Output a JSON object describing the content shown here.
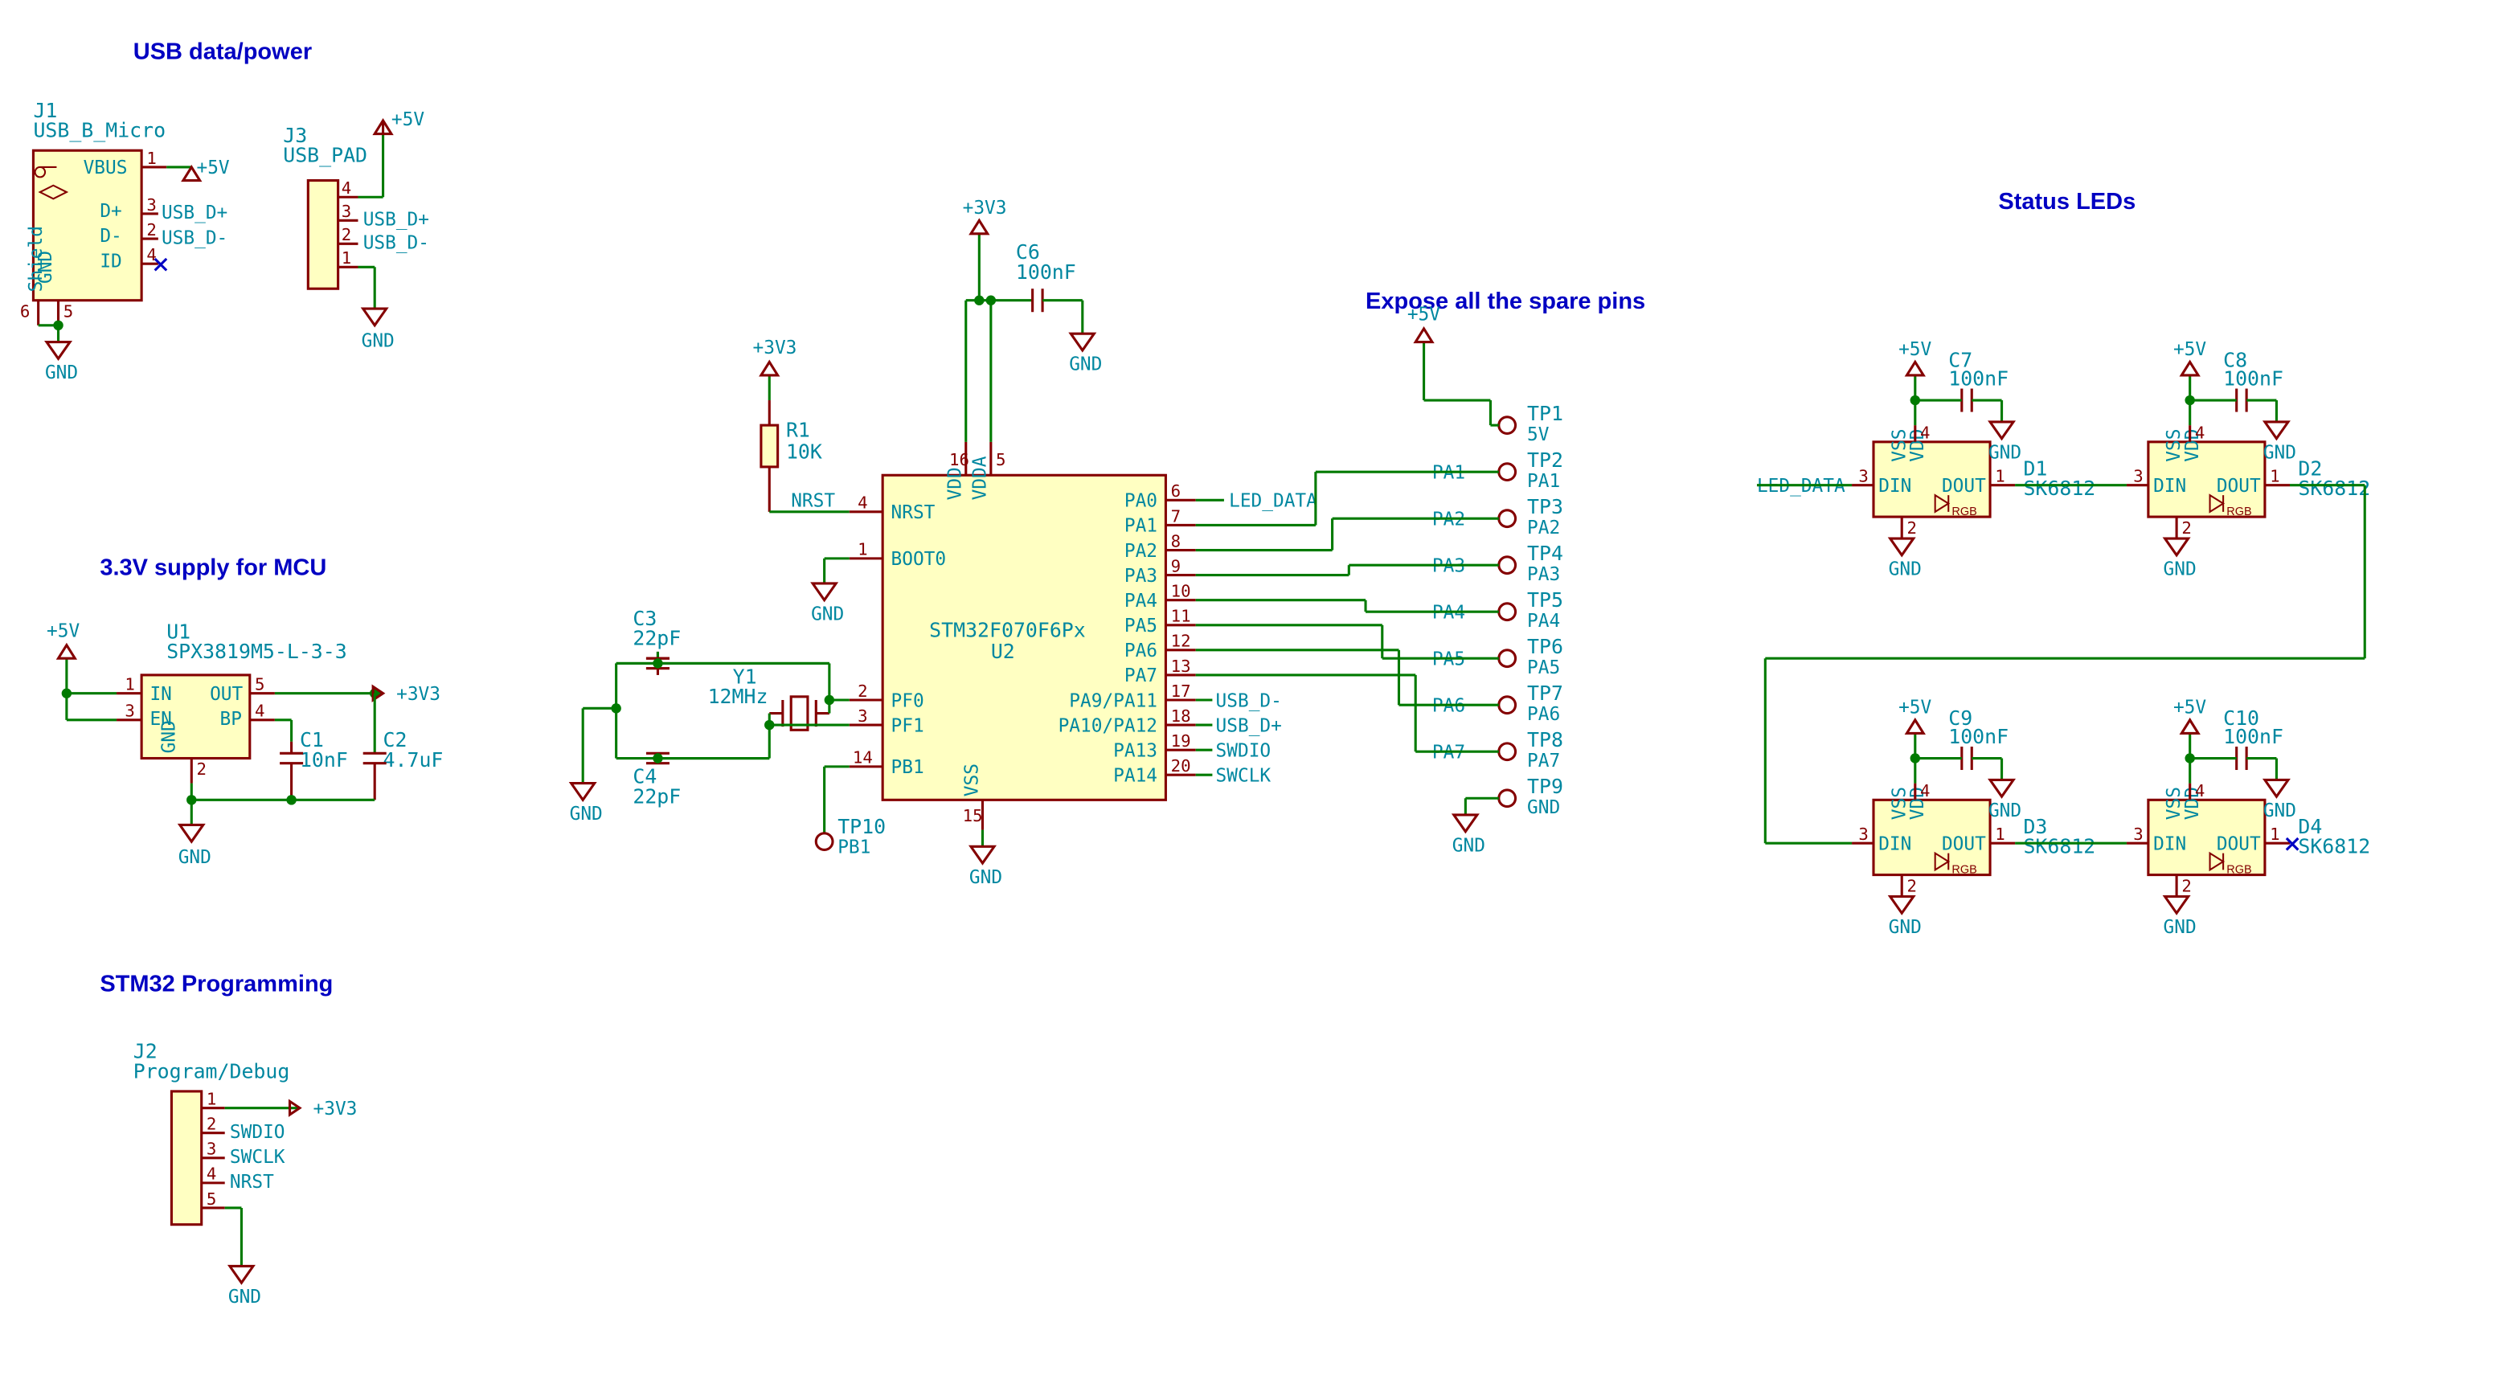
{
  "sections": {
    "usb": "USB data/power",
    "reg": "3.3V supply for MCU",
    "swd": "STM32 Programming",
    "leds": "Status LEDs",
    "spare": "Expose all the spare pins"
  },
  "components": {
    "J1": {
      "ref": "J1",
      "val": "USB_B_Micro",
      "pins": {
        "vbus": "VBUS",
        "dp": "D+",
        "dm": "D-",
        "id": "ID",
        "gnd": "GND",
        "sh": "Shield"
      }
    },
    "J3": {
      "ref": "J3",
      "val": "USB_PAD"
    },
    "U1": {
      "ref": "U1",
      "val": "SPX3819M5-L-3-3",
      "pins": {
        "in": "IN",
        "en": "EN",
        "gnd": "GND",
        "bp": "BP",
        "out": "OUT"
      }
    },
    "C1": {
      "ref": "C1",
      "val": "10nF"
    },
    "C2": {
      "ref": "C2",
      "val": "4.7uF"
    },
    "C3": {
      "ref": "C3",
      "val": "22pF"
    },
    "C4": {
      "ref": "C4",
      "val": "22pF"
    },
    "C6": {
      "ref": "C6",
      "val": "100nF"
    },
    "C7": {
      "ref": "C7",
      "val": "100nF"
    },
    "C8": {
      "ref": "C8",
      "val": "100nF"
    },
    "C9": {
      "ref": "C9",
      "val": "100nF"
    },
    "C10": {
      "ref": "C10",
      "val": "100nF"
    },
    "R1": {
      "ref": "R1",
      "val": "10K"
    },
    "Y1": {
      "ref": "Y1",
      "val": "12MHz"
    },
    "U2": {
      "ref": "U2",
      "val": "STM32F070F6Px",
      "left": [
        {
          "n": "4",
          "name": "NRST"
        },
        {
          "n": "1",
          "name": "BOOT0"
        },
        {
          "n": "2",
          "name": "PF0"
        },
        {
          "n": "3",
          "name": "PF1"
        },
        {
          "n": "14",
          "name": "PB1"
        }
      ],
      "top": [
        {
          "n": "16",
          "name": "VDD"
        },
        {
          "n": "5",
          "name": "VDDA"
        }
      ],
      "bottom": [
        {
          "n": "15",
          "name": "VSS"
        }
      ],
      "right": [
        {
          "n": "6",
          "name": "PA0"
        },
        {
          "n": "7",
          "name": "PA1"
        },
        {
          "n": "8",
          "name": "PA2"
        },
        {
          "n": "9",
          "name": "PA3"
        },
        {
          "n": "10",
          "name": "PA4"
        },
        {
          "n": "11",
          "name": "PA5"
        },
        {
          "n": "12",
          "name": "PA6"
        },
        {
          "n": "13",
          "name": "PA7"
        },
        {
          "n": "17",
          "name": "PA9/PA11"
        },
        {
          "n": "18",
          "name": "PA10/PA12"
        },
        {
          "n": "19",
          "name": "PA13"
        },
        {
          "n": "20",
          "name": "PA14"
        }
      ]
    },
    "J2": {
      "ref": "J2",
      "val": "Program/Debug"
    },
    "D1": {
      "ref": "D1",
      "val": "SK6812"
    },
    "D2": {
      "ref": "D2",
      "val": "SK6812"
    },
    "D3": {
      "ref": "D3",
      "val": "SK6812"
    },
    "D4": {
      "ref": "D4",
      "val": "SK6812"
    }
  },
  "nets": {
    "p5v": "+5V",
    "p3v3": "+3V3",
    "gnd": "GND",
    "usb_dp": "USB_D+",
    "usb_dm": "USB_D-",
    "led_data": "LED_DATA",
    "nrst": "NRST",
    "swdio": "SWDIO",
    "swclk": "SWCLK",
    "pb1": "PB1"
  },
  "testpoints": [
    {
      "ref": "TP1",
      "sig": "5V"
    },
    {
      "ref": "TP2",
      "sig": "PA1"
    },
    {
      "ref": "TP3",
      "sig": "PA2"
    },
    {
      "ref": "TP4",
      "sig": "PA3"
    },
    {
      "ref": "TP5",
      "sig": "PA4"
    },
    {
      "ref": "TP6",
      "sig": "PA5"
    },
    {
      "ref": "TP7",
      "sig": "PA6"
    },
    {
      "ref": "TP8",
      "sig": "PA7"
    },
    {
      "ref": "TP9",
      "sig": "GND"
    }
  ],
  "tp10": {
    "ref": "TP10",
    "sig": "PB1"
  },
  "spare_labels": [
    "PA1",
    "PA2",
    "PA3",
    "PA4",
    "PA5",
    "PA6",
    "PA7"
  ]
}
